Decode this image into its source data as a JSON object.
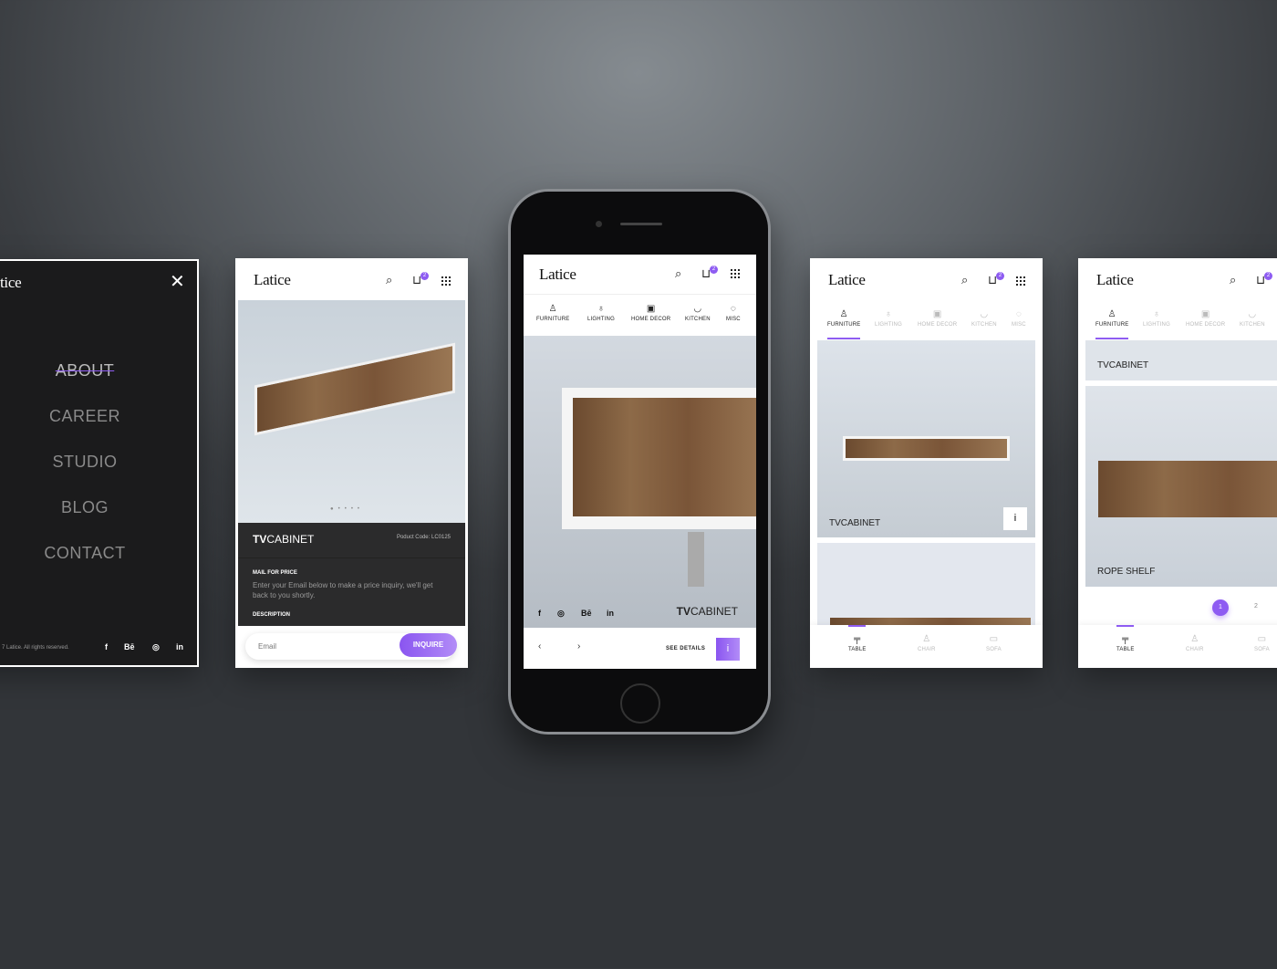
{
  "brand": {
    "name": "Latice",
    "accent": "#8e5cf2",
    "cart_count": "2"
  },
  "menu_screen": {
    "logo_partial": "tice",
    "items": [
      "ABOUT",
      "CAREER",
      "STUDIO",
      "BLOG",
      "CONTACT"
    ],
    "active": "ABOUT",
    "footer": "7 Latice. All rights reserved.",
    "social": [
      "f",
      "Bē",
      "◎",
      "in"
    ]
  },
  "detail_screen": {
    "title_bold": "TV",
    "title_rest": "CABINET",
    "product_code": "Poduct Code: LC0125",
    "mail_heading": "MAIL FOR PRICE",
    "mail_text": "Enter your Email below to make a price inquiry, we'll get back to you shortly.",
    "description_heading": "DESCRIPTION",
    "email_placeholder": "Email",
    "inquire_label": "INQUIRE",
    "carousel_dots": 5
  },
  "categories": [
    "FURNITURE",
    "LIGHTING",
    "HOME DECOR",
    "KITCHEN",
    "MISC"
  ],
  "phone_screen": {
    "title_bold": "TV",
    "title_rest": "CABINET",
    "social": [
      "f",
      "◎",
      "Bē",
      "in"
    ],
    "prev": "‹",
    "next": "›",
    "see_details": "SEE DETAILS",
    "info": "i"
  },
  "list_screen": {
    "cards": [
      {
        "title": "TVCABINET",
        "info": "i"
      }
    ],
    "subtabs": [
      "TABLE",
      "CHAIR",
      "SOFA"
    ]
  },
  "list_screen2": {
    "cards": [
      "TVCABINET",
      "ROPE SHELF"
    ],
    "pages": [
      "1",
      "2"
    ],
    "subtabs": [
      "TABLE",
      "CHAIR",
      "SOFA"
    ]
  }
}
